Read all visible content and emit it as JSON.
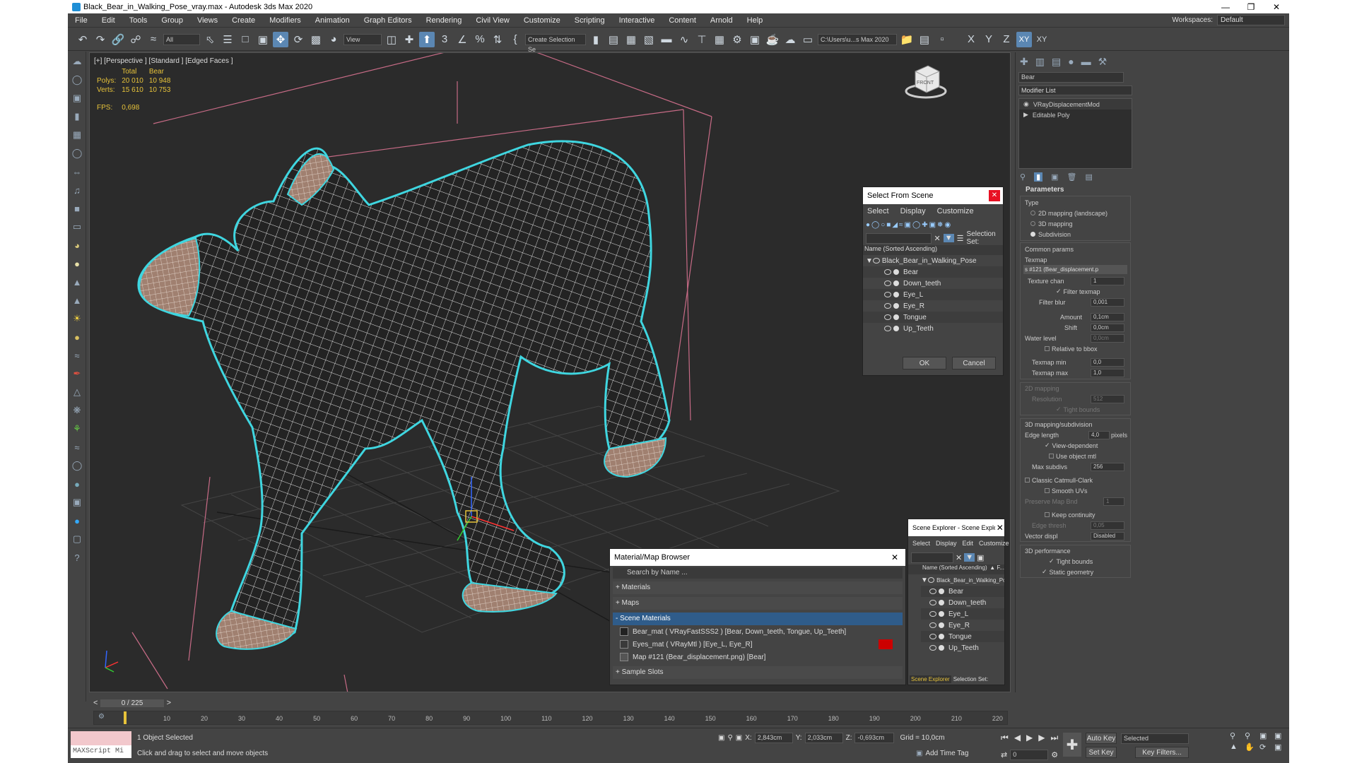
{
  "window": {
    "title": "Black_Bear_in_Walking_Pose_vray.max - Autodesk 3ds Max 2020"
  },
  "menu": [
    "File",
    "Edit",
    "Tools",
    "Group",
    "Views",
    "Create",
    "Modifiers",
    "Animation",
    "Graph Editors",
    "Rendering",
    "Civil View",
    "Customize",
    "Scripting",
    "Interactive",
    "Content",
    "Arnold",
    "Help"
  ],
  "workspace": {
    "label": "Workspaces:",
    "value": "Default"
  },
  "toolbar": {
    "filter": "All",
    "refcoord": "View",
    "selset": "Create Selection Se",
    "path": "C:\\Users\\u...s Max 2020",
    "axes": [
      "X",
      "Y",
      "Z",
      "XY",
      "XY"
    ]
  },
  "viewport": {
    "label": "[+] [Perspective ] [Standard ] [Edged Faces ]",
    "stats": {
      "col_total": "Total",
      "col_bear": "Bear",
      "polys_label": "Polys:",
      "polys_total": "20 010",
      "polys_bear": "10 948",
      "verts_label": "Verts:",
      "verts_total": "15 610",
      "verts_bear": "10 753",
      "fps_label": "FPS:",
      "fps": "0,698"
    },
    "viewcube_text": "FRONT"
  },
  "select_dialog": {
    "title": "Select From Scene",
    "menu": [
      "Select",
      "Display",
      "Customize"
    ],
    "selection_set_label": "Selection Set:",
    "column": "Name (Sorted Ascending)",
    "root": "Black_Bear_in_Walking_Pose",
    "items": [
      "Bear",
      "Down_teeth",
      "Eye_L",
      "Eye_R",
      "Tongue",
      "Up_Teeth"
    ],
    "ok": "OK",
    "cancel": "Cancel"
  },
  "scene_explorer": {
    "title": "Scene Explorer - Scene Explorer",
    "menu": [
      "Select",
      "Display",
      "Edit",
      "Customize"
    ],
    "column": "Name (Sorted Ascending)",
    "col2": "▲ F...",
    "root": "Black_Bear_in_Walking_Pose",
    "items": [
      "Bear",
      "Down_teeth",
      "Eye_L",
      "Eye_R",
      "Tongue",
      "Up_Teeth"
    ],
    "footer_name": "Scene Explorer",
    "selection_set_label": "Selection Set:"
  },
  "material_browser": {
    "title": "Material/Map Browser",
    "search": "Search by Name ...",
    "groups": [
      "+ Materials",
      "+ Maps",
      "- Scene Materials",
      "+ Sample Slots"
    ],
    "entries": [
      "Bear_mat  ( VRayFastSSS2 )  [Bear, Down_teeth, Tongue, Up_Teeth]",
      "Eyes_mat  ( VRayMtl )  [Eye_L, Eye_R]",
      "Map #121 (Bear_displacement.png)  [Bear]"
    ]
  },
  "command_panel": {
    "object_name": "Bear",
    "modifier_list": "Modifier List",
    "stack": [
      "VRayDisplacementMod",
      "Editable Poly"
    ],
    "parameters": "Parameters",
    "type_label": "Type",
    "types": [
      "2D mapping (landscape)",
      "3D mapping",
      "Subdivision"
    ],
    "common_params": "Common params",
    "texmap_label": "Texmap",
    "texmap_value": "s #121 (Bear_displacement.p",
    "texture_chan_label": "Texture chan",
    "texture_chan": "1",
    "filter_texmap": "Filter texmap",
    "filter_blur_label": "Filter blur",
    "filter_blur": "0,001",
    "amount_label": "Amount",
    "amount": "0,1cm",
    "shift_label": "Shift",
    "shift": "0,0cm",
    "water_label": "Water level",
    "water": "0,0cm",
    "relative_bbox": "Relative to bbox",
    "texmap_min_label": "Texmap min",
    "texmap_min": "0,0",
    "texmap_max_label": "Texmap max",
    "texmap_max": "1,0",
    "sec_2d": "2D mapping",
    "resolution_label": "Resolution",
    "resolution": "512",
    "tight_bounds": "Tight bounds",
    "sec_3d": "3D mapping/subdivision",
    "edge_length_label": "Edge length",
    "edge_length": "4,0",
    "pixels": "pixels",
    "view_dependent": "View-dependent",
    "use_object_mtl": "Use object mtl",
    "max_subdivs_label": "Max subdivs",
    "max_subdivs": "256",
    "classic_cc": "Classic Catmull-Clark",
    "smooth_uvs": "Smooth UVs",
    "preserve_map_label": "Preserve Map Bnd",
    "preserve_map": "1",
    "keep_continuity": "Keep continuity",
    "edge_thresh_label": "Edge thresh",
    "edge_thresh": "0,05",
    "vector_disp_label": "Vector displ",
    "vector_disp": "Disabled",
    "sec_perf": "3D performance",
    "tight_bounds2": "Tight bounds",
    "static_geometry": "Static geometry"
  },
  "timeline": {
    "frame": "0 / 225",
    "ticks": [
      "10",
      "20",
      "30",
      "40",
      "50",
      "60",
      "70",
      "80",
      "90",
      "100",
      "110",
      "120",
      "130",
      "140",
      "150",
      "160",
      "170",
      "180",
      "190",
      "200",
      "210",
      "220"
    ]
  },
  "status": {
    "maxscript": "MAXScript Mi",
    "selected": "1 Object Selected",
    "hint": "Click and drag to select and move objects",
    "x_label": "X:",
    "x": "2,843cm",
    "y_label": "Y:",
    "y": "2,033cm",
    "z_label": "Z:",
    "z": "-0,693cm",
    "grid": "Grid = 10,0cm",
    "add_time_tag": "Add Time Tag",
    "auto_key": "Auto Key",
    "set_key": "Set Key",
    "key_mode": "Selected",
    "key_filters": "Key Filters...",
    "frame_field": "0"
  }
}
